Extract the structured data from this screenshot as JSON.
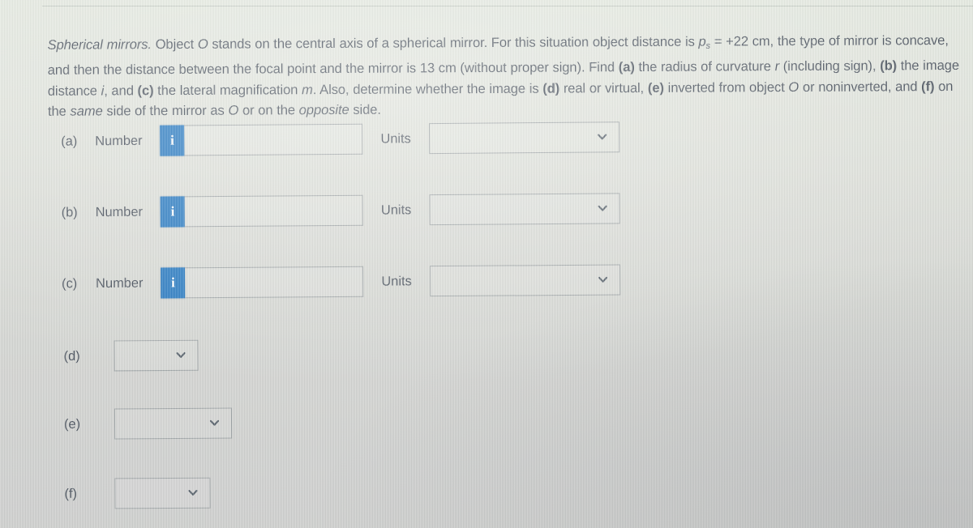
{
  "problem": {
    "topic": "Spherical mirrors.",
    "sentence_1_a": "Object ",
    "sentence_1_O": "O",
    "sentence_1_b": " stands on the central axis of a spherical mirror. For this situation object distance is ",
    "var_p": "p",
    "var_p_sub": "s",
    "sentence_1_c": " = +22 cm, the type of mirror is concave, and then the distance between the focal point and the mirror is 13 cm (without proper sign). Find ",
    "label_a": "(a)",
    "sentence_2_a": " the radius of curvature ",
    "var_r": "r",
    "sentence_2_b": " (including sign), ",
    "label_b": "(b)",
    "sentence_2_c": " the image distance ",
    "var_i": "i",
    "sentence_2_d": ", and ",
    "label_c": "(c)",
    "sentence_2_e": " the lateral magnification ",
    "var_m": "m",
    "sentence_2_f": ". Also, determine whether the image is ",
    "label_d": "(d)",
    "sentence_3_a": " real or virtual, ",
    "label_e": "(e)",
    "sentence_3_b": " inverted from object ",
    "sentence_3_O": "O",
    "sentence_3_c": " or noninverted, and ",
    "label_f": "(f)",
    "sentence_3_d": " on the ",
    "word_same": "same",
    "sentence_3_e": " side of the mirror as ",
    "sentence_3_O2": "O",
    "sentence_3_f": " or on the ",
    "word_opposite": "opposite",
    "sentence_3_g": " side."
  },
  "form": {
    "number_label": "Number",
    "units_label": "Units",
    "info_icon_glyph": "i",
    "chevron_icon": "chevron-down-icon",
    "accent_blue": "#1770bd",
    "text_color": "#3b4450",
    "border_color": "#9aa0a2",
    "rows": [
      {
        "part": "(a)",
        "number_label": "Number",
        "number_value": "",
        "number_placeholder": "",
        "units_label": "Units",
        "units_value": ""
      },
      {
        "part": "(b)",
        "number_label": "Number",
        "number_value": "",
        "number_placeholder": "",
        "units_label": "Units",
        "units_value": ""
      },
      {
        "part": "(c)",
        "number_label": "Number",
        "number_value": "",
        "number_placeholder": "",
        "units_label": "Units",
        "units_value": ""
      }
    ],
    "choice_rows": [
      {
        "part": "(d)",
        "value": ""
      },
      {
        "part": "(e)",
        "value": ""
      },
      {
        "part": "(f)",
        "value": ""
      }
    ]
  }
}
